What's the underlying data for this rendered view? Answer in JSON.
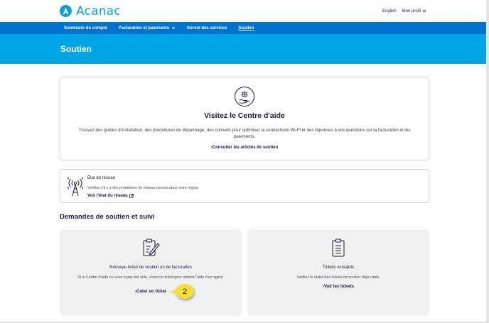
{
  "brand": {
    "name": "Acanac"
  },
  "top_links": {
    "language": "English",
    "profile": "Mon profil"
  },
  "nav": {
    "items": [
      {
        "label": "Sommaire du compte"
      },
      {
        "label": "Facturation et paiements"
      },
      {
        "label": "Survol des services"
      },
      {
        "label": "Soutien"
      }
    ]
  },
  "banner": {
    "title": "Soutien"
  },
  "help_center": {
    "title": "Visitez le Centre d'aide",
    "description": "Trouvez des guides d'installation, des procédures de dépannage, des conseils pour optimiser la connectivité Wi-Fi et des réponses à vos questions sur la facturation et les paiements.",
    "link": "Consulter les articles de soutien"
  },
  "network": {
    "title": "État du réseau",
    "description": "Vérifiez s'il y a des problèmes de réseau connus dans votre région.",
    "link": "Voir l'état du réseau"
  },
  "section": {
    "title": "Demandes de soutien et suivi"
  },
  "new_ticket": {
    "title": "Nouveau ticket de soutien ou de facturation",
    "description": "Si le Centre d'aide ne vous a pas été utile, créez un ticket pour obtenir l'aide d'un agent.",
    "link": "Créer un ticket"
  },
  "existing_tickets": {
    "title": "Tickets existants",
    "description": "Vérifiez le statut des tickets de soutien déjà créés.",
    "link": "Voir les tickets"
  },
  "step_badge": {
    "number": "2"
  },
  "colors": {
    "brand": "#0c9fda",
    "nav": "#0073cf",
    "banner": "#00a4e4",
    "callout": "#f7df3a"
  }
}
